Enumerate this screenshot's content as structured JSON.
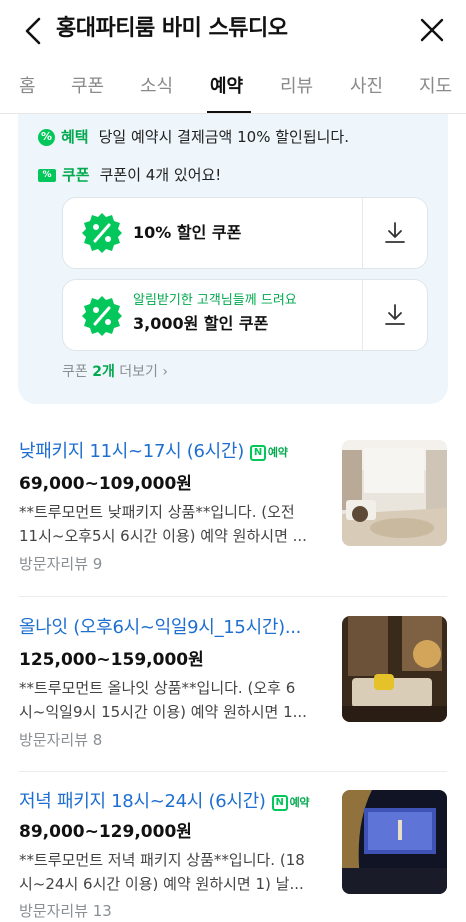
{
  "header": {
    "title": "홍대파티룸 바미 스튜디오",
    "back_icon": "chevron-left-icon",
    "close_icon": "close-icon"
  },
  "tabs": [
    {
      "label": "홈"
    },
    {
      "label": "쿠폰"
    },
    {
      "label": "소식"
    },
    {
      "label": "예약",
      "active": true
    },
    {
      "label": "리뷰"
    },
    {
      "label": "사진"
    },
    {
      "label": "지도"
    }
  ],
  "benefit": {
    "label": "혜택",
    "text": "당일 예약시 결제금액 10% 할인됩니다."
  },
  "coupon_section": {
    "label": "쿠폰",
    "text": "쿠폰이 4개 있어요!",
    "coupons": [
      {
        "title": "10% 할인 쿠폰",
        "subtitle": ""
      },
      {
        "title": "3,000원 할인 쿠폰",
        "subtitle": "알림받기한 고객님들께 드려요"
      }
    ],
    "more_prefix": "쿠폰 ",
    "more_count": "2개",
    "more_suffix": " 더보기 ›"
  },
  "items": [
    {
      "name": "낮패키지 11시~17시 (6시간)",
      "badge": "예약",
      "price": "69,000~109,000원",
      "desc_line1": "**트루모먼트 낮패키지 상품**입니다. (오전",
      "desc_line2": "11시~오후5시 6시간 이용) 예약 원하시면 ...",
      "reviews": "방문자리뷰 9"
    },
    {
      "name": "올나잇 (오후6시~익일9시_15시간)...",
      "badge": "",
      "price": "125,000~159,000원",
      "desc_line1": "**트루모먼트 올나잇 상품**입니다. (오후 6",
      "desc_line2": "시~익일9시 15시간 이용) 예약 원하시면 1...",
      "reviews": "방문자리뷰 8"
    },
    {
      "name": "저녁 패키지 18시~24시 (6시간)",
      "badge": "예약",
      "price": "89,000~129,000원",
      "desc_line1": "**트루모먼트 저녁 패키지 상품**입니다. (18",
      "desc_line2": "시~24시 6시간 이용) 예약 원하시면 1) 날...",
      "reviews": "방문자리뷰 13"
    }
  ],
  "colors": {
    "accent_green": "#03c75a",
    "link_blue": "#1e6fd0",
    "panel_bg": "#eef6fb"
  }
}
